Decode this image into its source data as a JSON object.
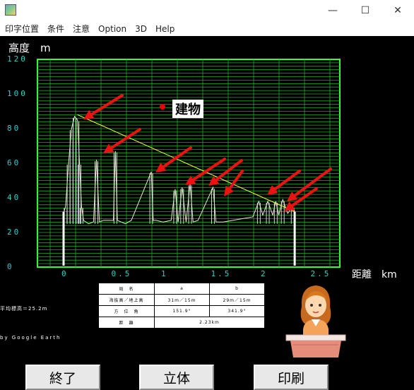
{
  "window": {
    "minimize": "—",
    "maximize": "☐",
    "close": "✕"
  },
  "menu": [
    {
      "label": "印字位置"
    },
    {
      "label": "条件"
    },
    {
      "label": "注意"
    },
    {
      "label": "Option"
    },
    {
      "label": "3D"
    },
    {
      "label": "Help"
    }
  ],
  "chart_data": {
    "type": "line",
    "ylabel": "高度　m",
    "xlabel": "距離　km",
    "xlim": [
      0,
      2.7
    ],
    "ylim": [
      0,
      120
    ],
    "x_ticks": [
      "0",
      "0.5",
      "1",
      "1.5",
      "2",
      "2.5"
    ],
    "y_ticks": [
      "120",
      "100",
      "80",
      "60",
      "40",
      "20",
      "0"
    ],
    "grid": true,
    "line_of_sight": {
      "from": [
        0.14,
        88
      ],
      "to": [
        2.32,
        32
      ]
    },
    "building_annotation": "建物",
    "series": [
      {
        "x": [
          0.0,
          0.02,
          0.05,
          0.08,
          0.11,
          0.14,
          0.16,
          0.18,
          0.2,
          0.25,
          0.3,
          0.33,
          0.36,
          0.4,
          0.5,
          0.52,
          0.54,
          0.58,
          0.62,
          0.68,
          0.88,
          0.9,
          0.93,
          1.0,
          1.08,
          1.12,
          1.15,
          1.19,
          1.23,
          1.27,
          1.3,
          1.35,
          1.5,
          1.53,
          1.6,
          1.7,
          1.8,
          1.9,
          1.96,
          2.0,
          2.05,
          2.1,
          2.13,
          2.16,
          2.2,
          2.25,
          2.3,
          2.32
        ],
        "values": [
          31,
          35,
          60,
          80,
          87,
          85,
          60,
          35,
          27,
          25,
          26,
          62,
          26,
          27,
          27,
          67,
          27,
          26,
          25,
          27,
          55,
          27,
          27,
          26,
          27,
          45,
          26,
          46,
          26,
          48,
          26,
          27,
          46,
          26,
          26,
          27,
          28,
          29,
          38,
          30,
          38,
          30,
          38,
          30,
          39,
          31,
          35,
          32
        ]
      }
    ],
    "observer_poles": [
      0.0,
      2.32
    ]
  },
  "axis": {
    "y_unit": "高度　m",
    "x_unit": "距離　km",
    "y_ticks": [
      "120",
      "100",
      "80",
      "60",
      "40",
      "20",
      "0"
    ],
    "x_ticks": [
      "0",
      "0.5",
      "1",
      "1.5",
      "2",
      "2.5"
    ]
  },
  "annotation": {
    "building": "建物"
  },
  "side_notes": {
    "left_height": "平均標高＝25.2m",
    "credit": "by Google Earth"
  },
  "table": {
    "headers": [
      "局　名",
      "a",
      "b"
    ],
    "rows": [
      [
        "海抜高／地上高",
        "31m／15m",
        "29m／15m"
      ],
      [
        "方　位　角",
        "151.9°",
        "341.9°"
      ]
    ],
    "distance_label": "距　離",
    "distance_value": "2.23km"
  },
  "buttons": {
    "exit": "終了",
    "threed": "立体",
    "print": "印刷"
  }
}
